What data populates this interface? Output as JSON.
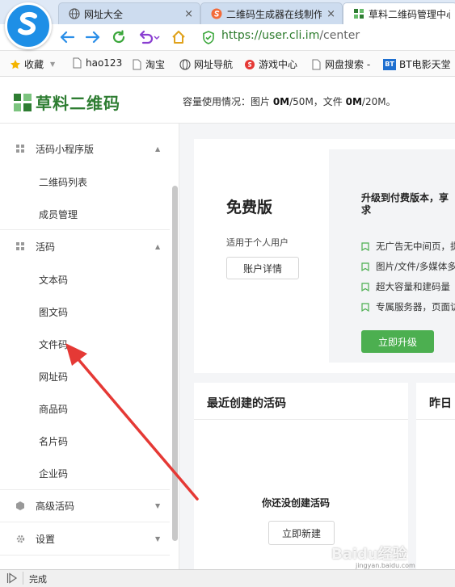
{
  "browser": {
    "tabs": [
      {
        "title": "网址大全",
        "icon": "globe-icon"
      },
      {
        "title": "二维码生成器在线制作",
        "icon": "sogou-icon"
      },
      {
        "title": "草料二维码管理中心",
        "icon": "cli-logo-icon"
      }
    ],
    "close_glyph": "×",
    "address": {
      "host": "https://user.cli.im",
      "path": "/center"
    },
    "bookmarks": [
      {
        "label": "收藏",
        "icon": "star-icon"
      },
      {
        "label": "hao123",
        "icon": "page-icon"
      },
      {
        "label": "淘宝",
        "icon": "page-icon"
      },
      {
        "label": "网址导航",
        "icon": "globe-icon"
      },
      {
        "label": "游戏中心",
        "icon": "game-icon"
      },
      {
        "label": "网盘搜索 -",
        "icon": "page-icon"
      },
      {
        "label": "BT电影天堂",
        "icon": "bt-icon"
      }
    ],
    "bt_badge": "BT",
    "status": "完成"
  },
  "header": {
    "logo_text": "草料二维码",
    "capacity": {
      "prefix": "容量使用情况：图片 ",
      "image_used": "0M",
      "image_total": "/50M，文件 ",
      "file_used": "0M",
      "file_total": "/20M。"
    }
  },
  "sidebar": {
    "groups": [
      {
        "label": "活码小程序版",
        "icon": "grid-icon",
        "items": [
          "二维码列表",
          "成员管理"
        ]
      },
      {
        "label": "活码",
        "icon": "grid-icon",
        "items": [
          "文本码",
          "图文码",
          "文件码",
          "网址码",
          "商品码",
          "名片码",
          "企业码"
        ]
      },
      {
        "label": "高级活码",
        "icon": "cube-icon",
        "items": []
      },
      {
        "label": "设置",
        "icon": "gear-icon",
        "items": []
      }
    ],
    "arrow_up": "▲",
    "arrow_down": "▼"
  },
  "plan": {
    "title": "免费版",
    "subtitle": "适用于个人用户",
    "details_button": "账户详情",
    "upgrade_title_l1": "升级到付费版本，享",
    "upgrade_title_l2": "求",
    "features": [
      "无广告无中间页，提",
      "图片/文件/多媒体多",
      "超大容量和建码量",
      "专属服务器，页面访"
    ],
    "upgrade_button": "立即升级"
  },
  "recent": {
    "title": "最近创建的活码",
    "empty_text": "你还没创建活码",
    "create_button": "立即新建"
  },
  "yesterday": {
    "title": "昨日"
  },
  "watermark": {
    "text": "Baidu经验",
    "sub": "jingyan.baidu.com"
  },
  "colors": {
    "accent_green": "#4caf50",
    "logo_green": "#2e7d32",
    "browser_blue": "#1e8fe6",
    "annotation_red": "#e53935"
  }
}
